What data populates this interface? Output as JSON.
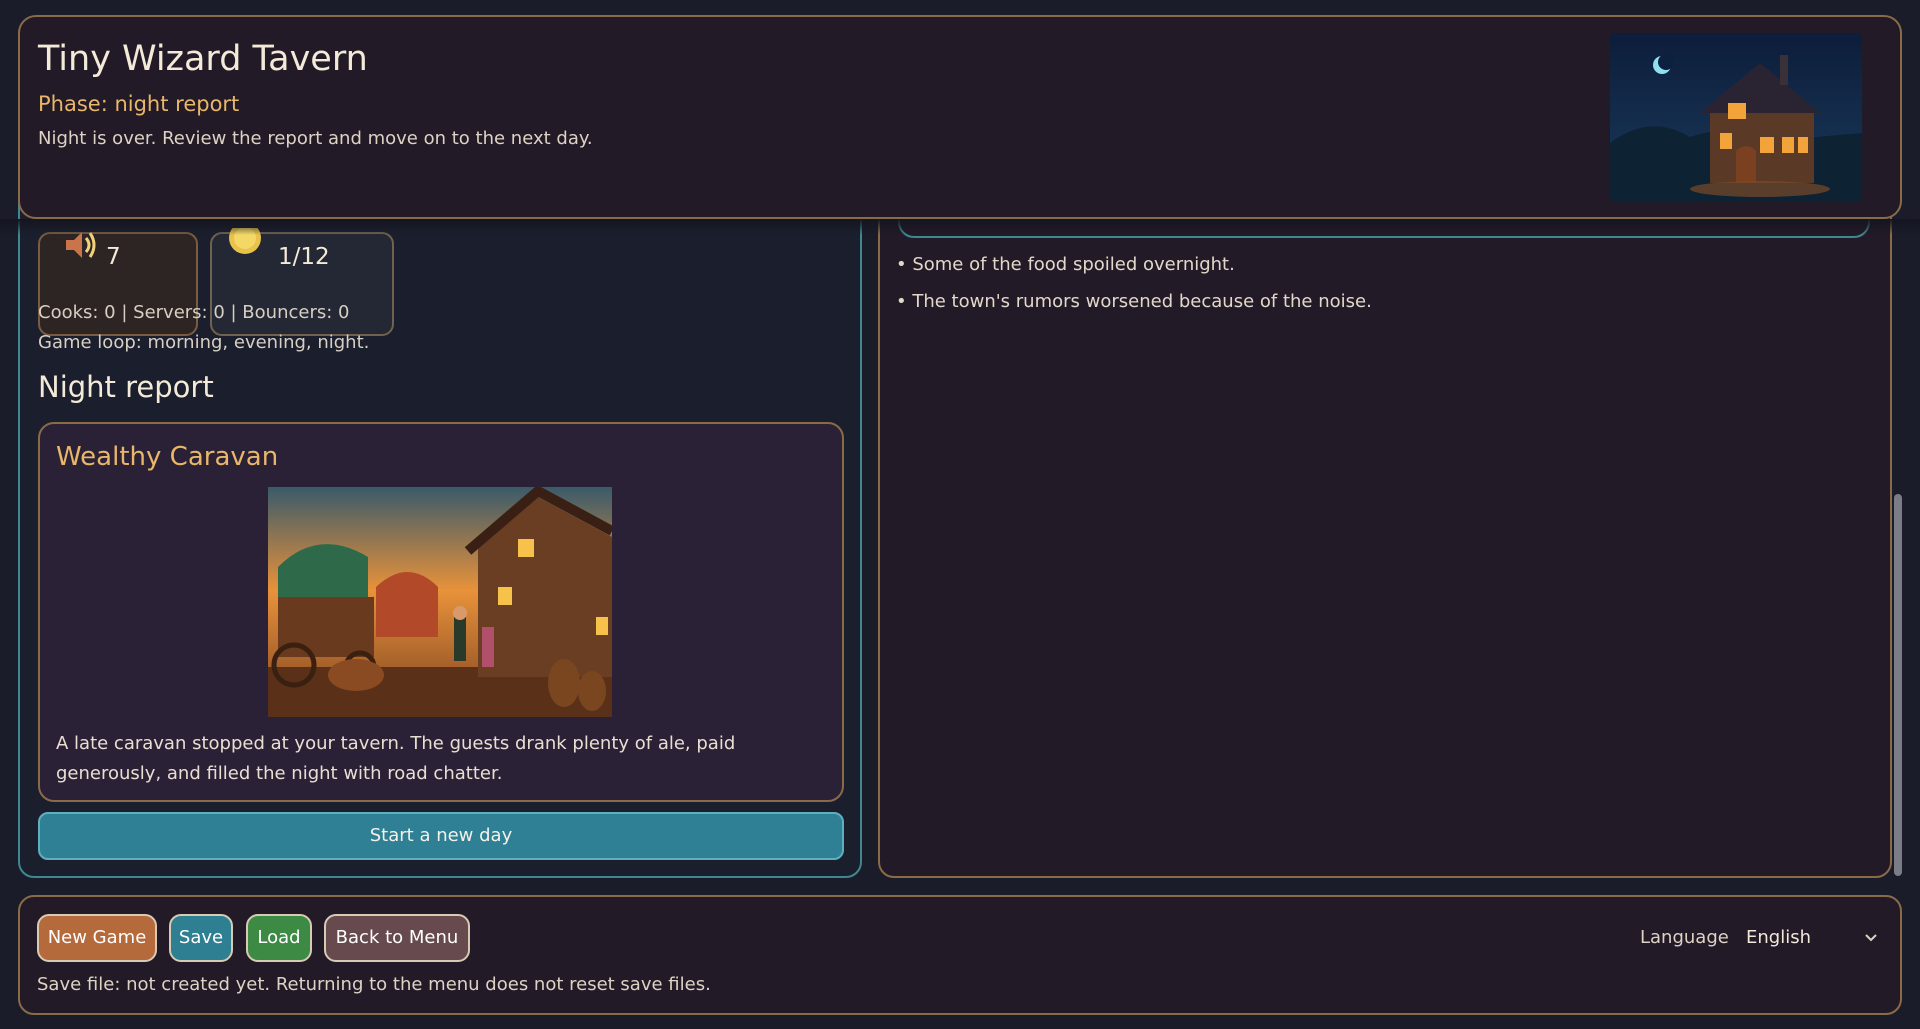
{
  "header": {
    "title": "Tiny Wizard Tavern",
    "phase": "Phase: night report",
    "description": "Night is over. Review the report and move on to the next day.",
    "art_icon": "tavern-night-illustration"
  },
  "stats": {
    "noise": {
      "value": "7",
      "icon": "noise-icon"
    },
    "gold": {
      "value": "1/12",
      "icon": "gold-coin-icon"
    }
  },
  "staff_line": "Cooks: 0 | Servers: 0 | Bouncers: 0",
  "loop_line": "Game loop: morning, evening, night.",
  "night_report": {
    "heading": "Night report",
    "event_title": "Wealthy Caravan",
    "event_image": "caravan-illustration",
    "event_text": "A late caravan stopped at your tavern. The guests drank plenty of ale, paid generously, and filled the night with road chatter.",
    "start_button": "Start a new day"
  },
  "report_lines": [
    "• Some of the food spoiled overnight.",
    "• The town's rumors worsened because of the noise."
  ],
  "footer": {
    "new_game": "New Game",
    "save": "Save",
    "load": "Load",
    "back": "Back to Menu",
    "note": "Save file: not created yet. Returning to the menu does not reset save files.",
    "language_label": "Language",
    "language_value": "English"
  },
  "colors": {
    "accent_gold": "#e9b66a",
    "accent_teal": "#2f8094",
    "border_brown": "#8a6b48"
  }
}
